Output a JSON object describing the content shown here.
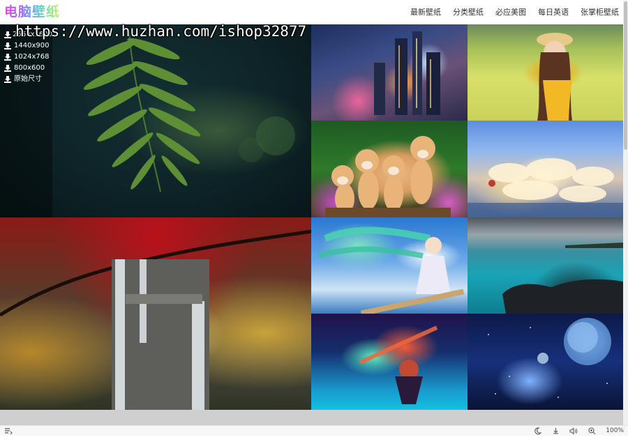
{
  "header": {
    "logo": "电脑壁纸",
    "nav": [
      "最新壁纸",
      "分类壁纸",
      "必应美图",
      "每日英语",
      "张掌柜壁纸"
    ]
  },
  "watermark": "https://www.huzhan.com/ishop32877",
  "resolutions": [
    "2560x1600",
    "1440x900",
    "1024x768",
    "800x600",
    "原始尺寸"
  ],
  "statusbar": {
    "zoom": "100%"
  }
}
